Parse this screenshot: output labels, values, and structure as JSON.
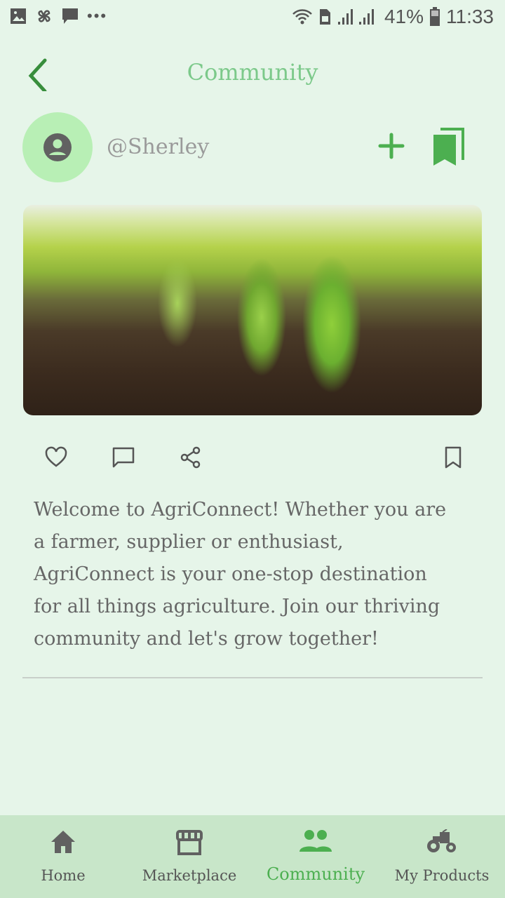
{
  "status_bar": {
    "battery": "41%",
    "time": "11:33"
  },
  "header": {
    "title": "Community"
  },
  "profile": {
    "username": "@Sherley"
  },
  "post": {
    "text": "Welcome to AgriConnect! Whether you are a farmer, supplier or enthusiast, AgriConnect is your one-stop destination for all things agriculture. Join our thriving community and let's grow together!"
  },
  "nav": {
    "items": [
      {
        "label": "Home"
      },
      {
        "label": "Marketplace"
      },
      {
        "label": "Community"
      },
      {
        "label": "My Products"
      }
    ],
    "active": "Community"
  },
  "colors": {
    "accent": "#4caf50",
    "title": "#7cc98a",
    "background": "#e6f5e9",
    "nav": "#c8e6c9"
  }
}
